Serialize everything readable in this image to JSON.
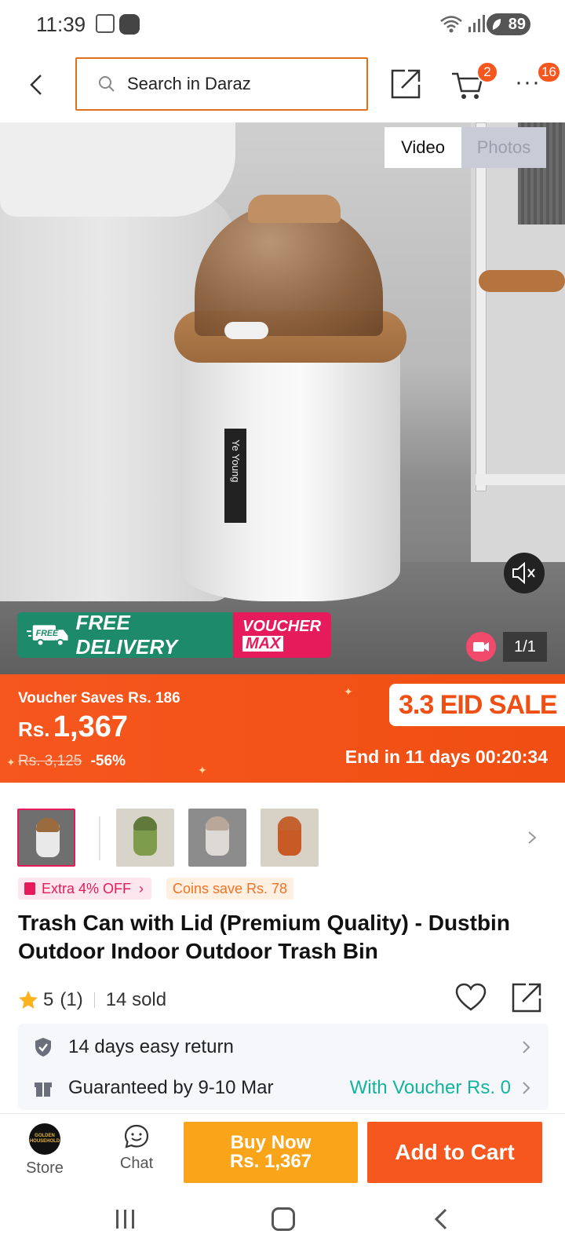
{
  "status_bar": {
    "time": "11:39",
    "battery": "89"
  },
  "search": {
    "placeholder": "Search in Daraz"
  },
  "header": {
    "cart_count": "2",
    "more_count": "16"
  },
  "media": {
    "tabs": [
      {
        "label": "Video",
        "active": true
      },
      {
        "label": "Photos",
        "active": false
      }
    ],
    "counter": "1/1",
    "promo_free": "FREE DELIVERY",
    "promo_free_small": "FREE",
    "promo_voucher_line1": "VOUCHER",
    "promo_voucher_line2": "MAX",
    "bin_brand": "Ye Young"
  },
  "price": {
    "voucher_saves": "Voucher Saves Rs. 186",
    "currency": "Rs.",
    "amount": "1,367",
    "original": "Rs. 3,125",
    "discount": "-56%",
    "sale_badge": "3.3 EID SALE",
    "countdown": "End in 11 days 00:20:34"
  },
  "thumbnails": [
    {
      "color_lid": "#9a6b3e",
      "color_body": "#e9e9e9",
      "bg": "#6f6f6f",
      "selected": true
    },
    {
      "color_lid": "#5f7a3a",
      "color_body": "#7e9c4c",
      "bg": "#d9d4c9",
      "selected": false
    },
    {
      "color_lid": "#b9a899",
      "color_body": "#dddad5",
      "bg": "#8c8c8c",
      "selected": false
    },
    {
      "color_lid": "#c2622e",
      "color_body": "#c85a26",
      "bg": "#d7d1c6",
      "selected": false
    }
  ],
  "tags": {
    "extra_off": "Extra 4% OFF",
    "coins_save": "Coins save Rs. 78"
  },
  "product": {
    "title": "Trash Can with Lid (Premium Quality) - Dustbin Outdoor Indoor Outdoor Trash Bin",
    "rating": "5",
    "rating_count": "(1)",
    "sold": "14 sold"
  },
  "services": {
    "return": "14 days easy return",
    "guarantee": "Guaranteed by 9-10 Mar",
    "voucher": "With Voucher Rs. 0"
  },
  "actions": {
    "store": "Store",
    "store_logo": "GOLDEN HOUSEHOLD",
    "chat": "Chat",
    "buy_now_label": "Buy Now",
    "buy_now_price": "Rs. 1,367",
    "add_to_cart": "Add to Cart"
  },
  "colors": {
    "accent": "#f6571e",
    "buy_now": "#faa41a",
    "voucher_green": "#13b39e",
    "pink": "#e61b5b"
  }
}
